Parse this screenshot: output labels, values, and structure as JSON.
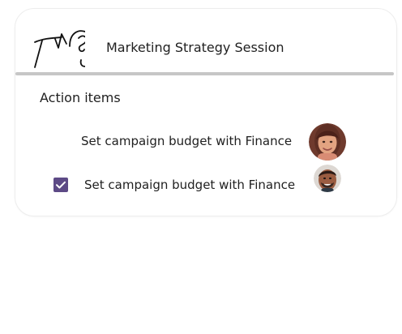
{
  "meeting": {
    "title": "Marketing Strategy Session"
  },
  "section": {
    "title": "Action items"
  },
  "action_items": [
    {
      "text": "Set campaign budget with Finance",
      "checked": false,
      "avatar_icon": "woman-portrait-icon"
    },
    {
      "text": "Set campaign budget with Finance",
      "checked": true,
      "avatar_icon": "man-portrait-icon"
    }
  ],
  "icons": {
    "logo": "ear-logo-icon",
    "checkbox": "checkbox-checked-icon"
  },
  "colors": {
    "accent": "#5d4a86",
    "divider": "#c6c6c6",
    "border": "#ededed",
    "text": "#1f1f1f"
  }
}
